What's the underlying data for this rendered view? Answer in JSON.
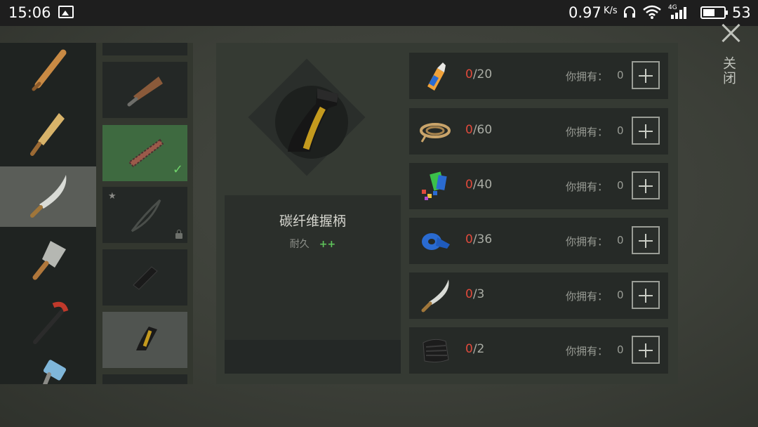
{
  "status_bar": {
    "time": "15:06",
    "speed": "0.97",
    "speed_unit": "K/s",
    "signal_type": "4G",
    "battery": "53"
  },
  "weapons": [
    {
      "name": "baseball-bat-icon"
    },
    {
      "name": "plank-icon"
    },
    {
      "name": "machete-icon",
      "selected": true
    },
    {
      "name": "cleaver-icon"
    },
    {
      "name": "crowbar-icon"
    },
    {
      "name": "sledgehammer-icon"
    }
  ],
  "parts": [
    {
      "name": "part-top-partial"
    },
    {
      "name": "rusty-blade-part-icon"
    },
    {
      "name": "chainsaw-blade-part-icon",
      "equipped": true
    },
    {
      "name": "shadow-blade-part-icon",
      "locked": true,
      "starred": true
    },
    {
      "name": "black-grip-part-icon"
    },
    {
      "name": "carbon-fiber-grip-part-icon",
      "current": true
    }
  ],
  "selected_part": {
    "name": "碳纤维握柄",
    "stat_label": "耐久",
    "stat_value": "++"
  },
  "requirements": [
    {
      "icon": "glue-icon",
      "have": "0",
      "need": "/20",
      "own_label": "你拥有：",
      "own_value": "0"
    },
    {
      "icon": "rope-icon",
      "have": "0",
      "need": "/60",
      "own_label": "你拥有：",
      "own_value": "0"
    },
    {
      "icon": "plastic-scraps-icon",
      "have": "0",
      "need": "/40",
      "own_label": "你拥有：",
      "own_value": "0"
    },
    {
      "icon": "tape-icon",
      "have": "0",
      "need": "/36",
      "own_label": "你拥有：",
      "own_value": "0"
    },
    {
      "icon": "machete-icon",
      "have": "0",
      "need": "/3",
      "own_label": "你拥有：",
      "own_value": "0"
    },
    {
      "icon": "carbon-fiber-icon",
      "have": "0",
      "need": "/2",
      "own_label": "你拥有：",
      "own_value": "0"
    }
  ],
  "close_label": "关闭",
  "colors": {
    "have_count": "#e04a3c",
    "stat_bonus": "#5ec35a",
    "equipped_slot": "#3e6a40"
  }
}
